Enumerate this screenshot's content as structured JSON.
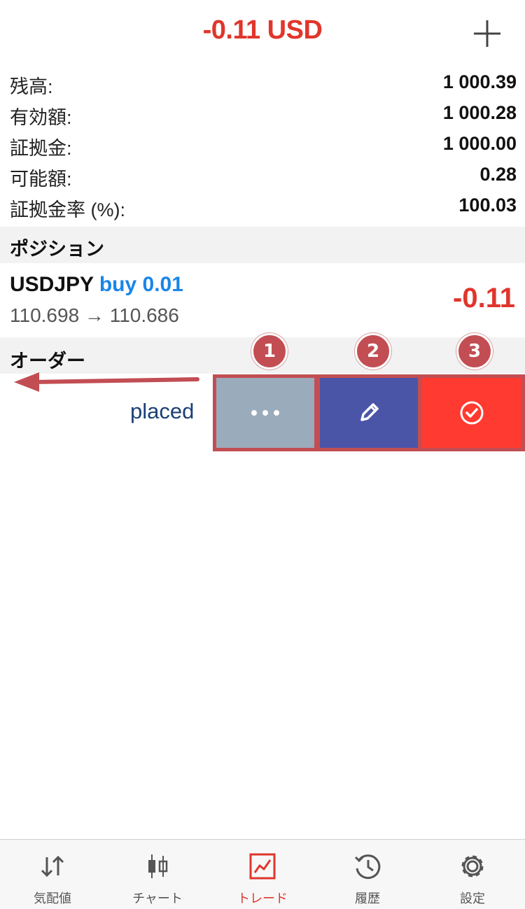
{
  "header": {
    "title": "-0.11 USD",
    "plus_icon": "plus-icon"
  },
  "summary": [
    {
      "label": "残高:",
      "value": "1 000.39"
    },
    {
      "label": "有効額:",
      "value": "1 000.28"
    },
    {
      "label": "証拠金:",
      "value": "1 000.00"
    },
    {
      "label": "可能額:",
      "value": "0.28"
    },
    {
      "label": "証拠金率 (%):",
      "value": "100.03"
    }
  ],
  "positions": {
    "section_title": "ポジション",
    "items": [
      {
        "symbol": "USDJPY",
        "direction": "buy 0.01",
        "prices": "110.698 → 110.686",
        "profit": "-0.11"
      }
    ]
  },
  "orders": {
    "section_title": "オーダー",
    "status": "placed",
    "actions": [
      {
        "icon": "more-icon",
        "badge": "1",
        "color": "#9aabbc"
      },
      {
        "icon": "pencil-icon",
        "badge": "2",
        "color": "#4b55a8"
      },
      {
        "icon": "check-circle-icon",
        "badge": "3",
        "color": "#ff3a30"
      }
    ]
  },
  "tabs": [
    {
      "label": "気配値",
      "icon": "quotes-icon",
      "active": false
    },
    {
      "label": "チャート",
      "icon": "chart-icon",
      "active": false
    },
    {
      "label": "トレード",
      "icon": "trade-icon",
      "active": true
    },
    {
      "label": "履歴",
      "icon": "history-icon",
      "active": false
    },
    {
      "label": "設定",
      "icon": "settings-icon",
      "active": false
    }
  ],
  "colors": {
    "accent_red": "#e0362c",
    "buy_blue": "#1a86e8",
    "annotation": "#c24e53"
  }
}
